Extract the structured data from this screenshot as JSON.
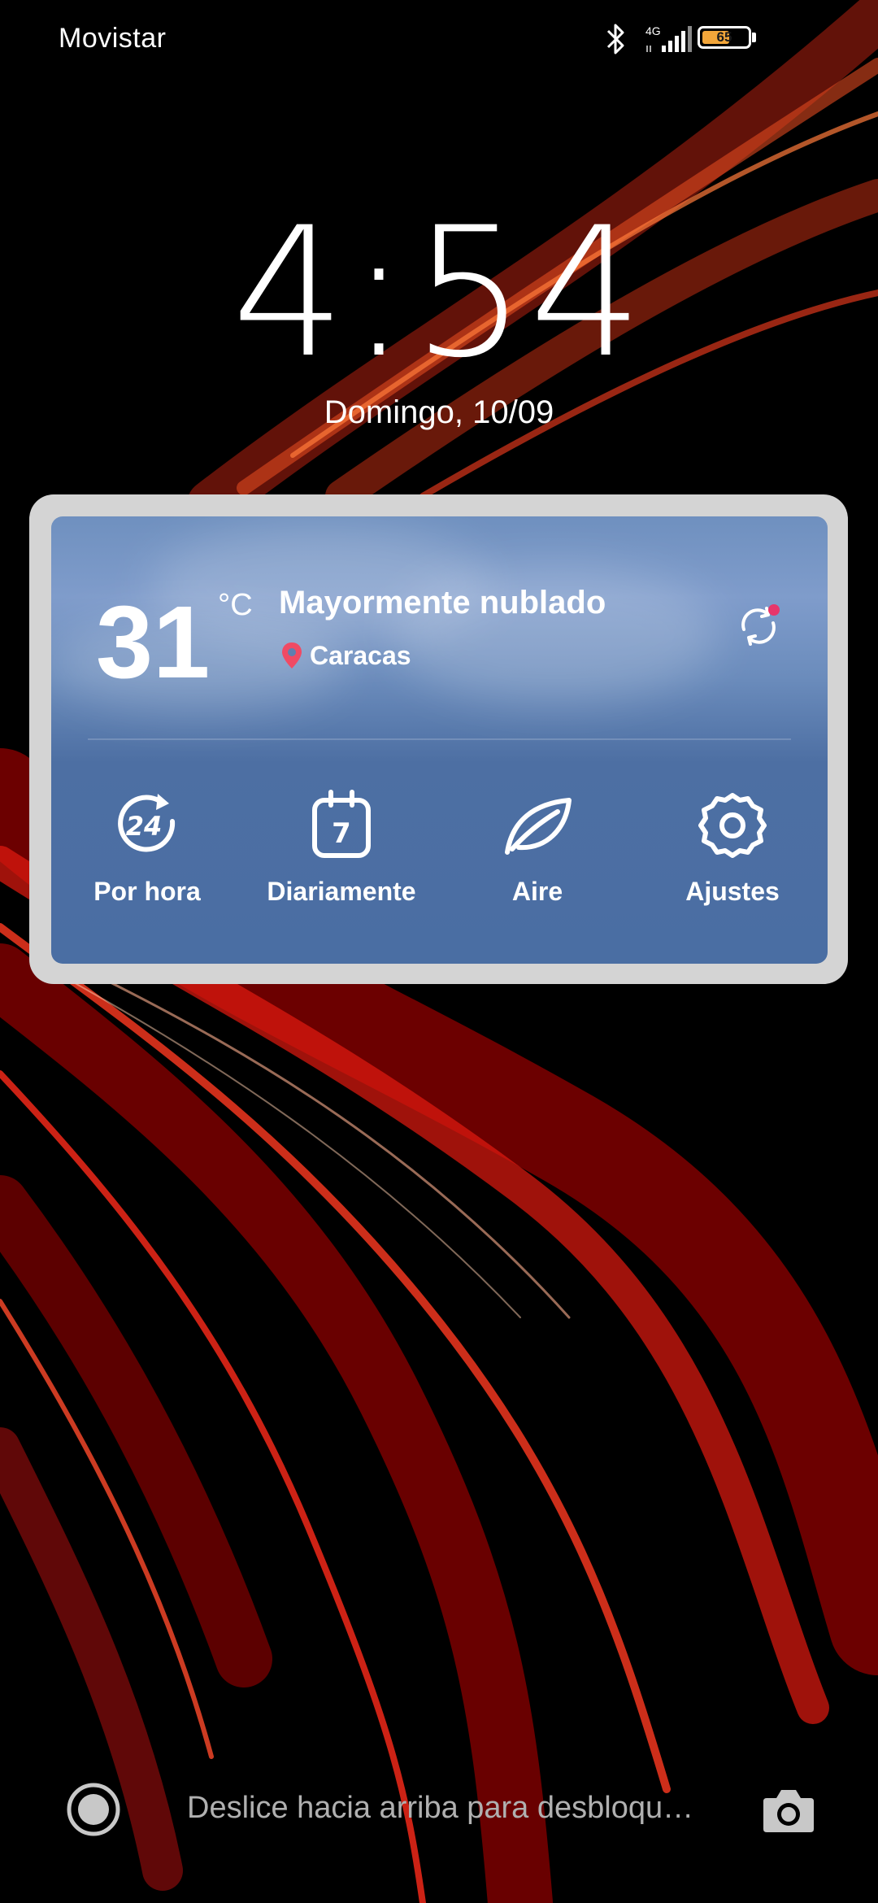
{
  "status_bar": {
    "carrier": "Movistar",
    "network_type": "4G",
    "battery_level": "65",
    "icons": [
      "bluetooth-icon",
      "signal-icon",
      "battery-icon"
    ]
  },
  "lockscreen": {
    "time": "4:54",
    "date": "Domingo, 10/09"
  },
  "weather": {
    "temperature": "31",
    "unit": "°C",
    "condition": "Mayormente nublado",
    "city": "Caracas",
    "actions": [
      {
        "label": "Por hora",
        "icon": "hourly-24-icon"
      },
      {
        "label": "Diariamente",
        "icon": "calendar-7-icon"
      },
      {
        "label": "Aire",
        "icon": "leaf-icon"
      },
      {
        "label": "Ajustes",
        "icon": "gear-icon"
      }
    ],
    "hourly_badge": "24",
    "daily_badge": "7"
  },
  "bottom": {
    "hint": "Deslice hacia arriba para desbloqu…",
    "left_icon": "assistant-icon",
    "right_icon": "camera-icon"
  },
  "colors": {
    "accent_red": "#c81414",
    "card_blue": "#4a6ea3",
    "battery": "#f2a63a",
    "notification_dot": "#e8366b",
    "location_pin": "#f04a64"
  }
}
